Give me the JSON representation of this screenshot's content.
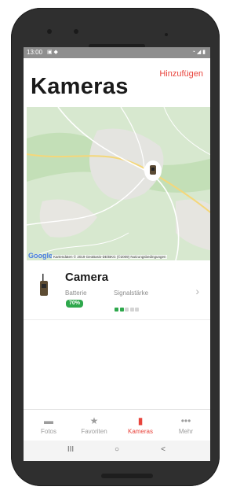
{
  "status_bar": {
    "time": "13:00",
    "left_icons": "▣ ◆",
    "right_icons": "◔ ◢ ▮"
  },
  "header": {
    "title": "Kameras",
    "add_label": "Hinzufügen"
  },
  "map": {
    "provider_logo": "Google",
    "credit": "Kartendaten © 2019 GeoBasis-DE/BKG (©2009)   Nutzungsbedingungen"
  },
  "camera": {
    "name": "Camera",
    "battery_label": "Batterie",
    "battery_value": "70%",
    "signal_label": "Signalstärke",
    "signal_level": 2,
    "signal_max": 5
  },
  "tabs": [
    {
      "label": "Fotos",
      "icon": "photos-icon",
      "glyph": "▬",
      "active": false
    },
    {
      "label": "Favoriten",
      "icon": "star-icon",
      "glyph": "★",
      "active": false
    },
    {
      "label": "Kameras",
      "icon": "camera-icon",
      "glyph": "▮",
      "active": true
    },
    {
      "label": "Mehr",
      "icon": "more-icon",
      "glyph": "•••",
      "active": false
    }
  ],
  "nav": {
    "recent": "III",
    "home": "○",
    "back": "<"
  },
  "colors": {
    "accent": "#e8443c",
    "battery": "#2ea84c",
    "signal_on": "#2ea84c",
    "signal_off": "#d4d4d4"
  }
}
